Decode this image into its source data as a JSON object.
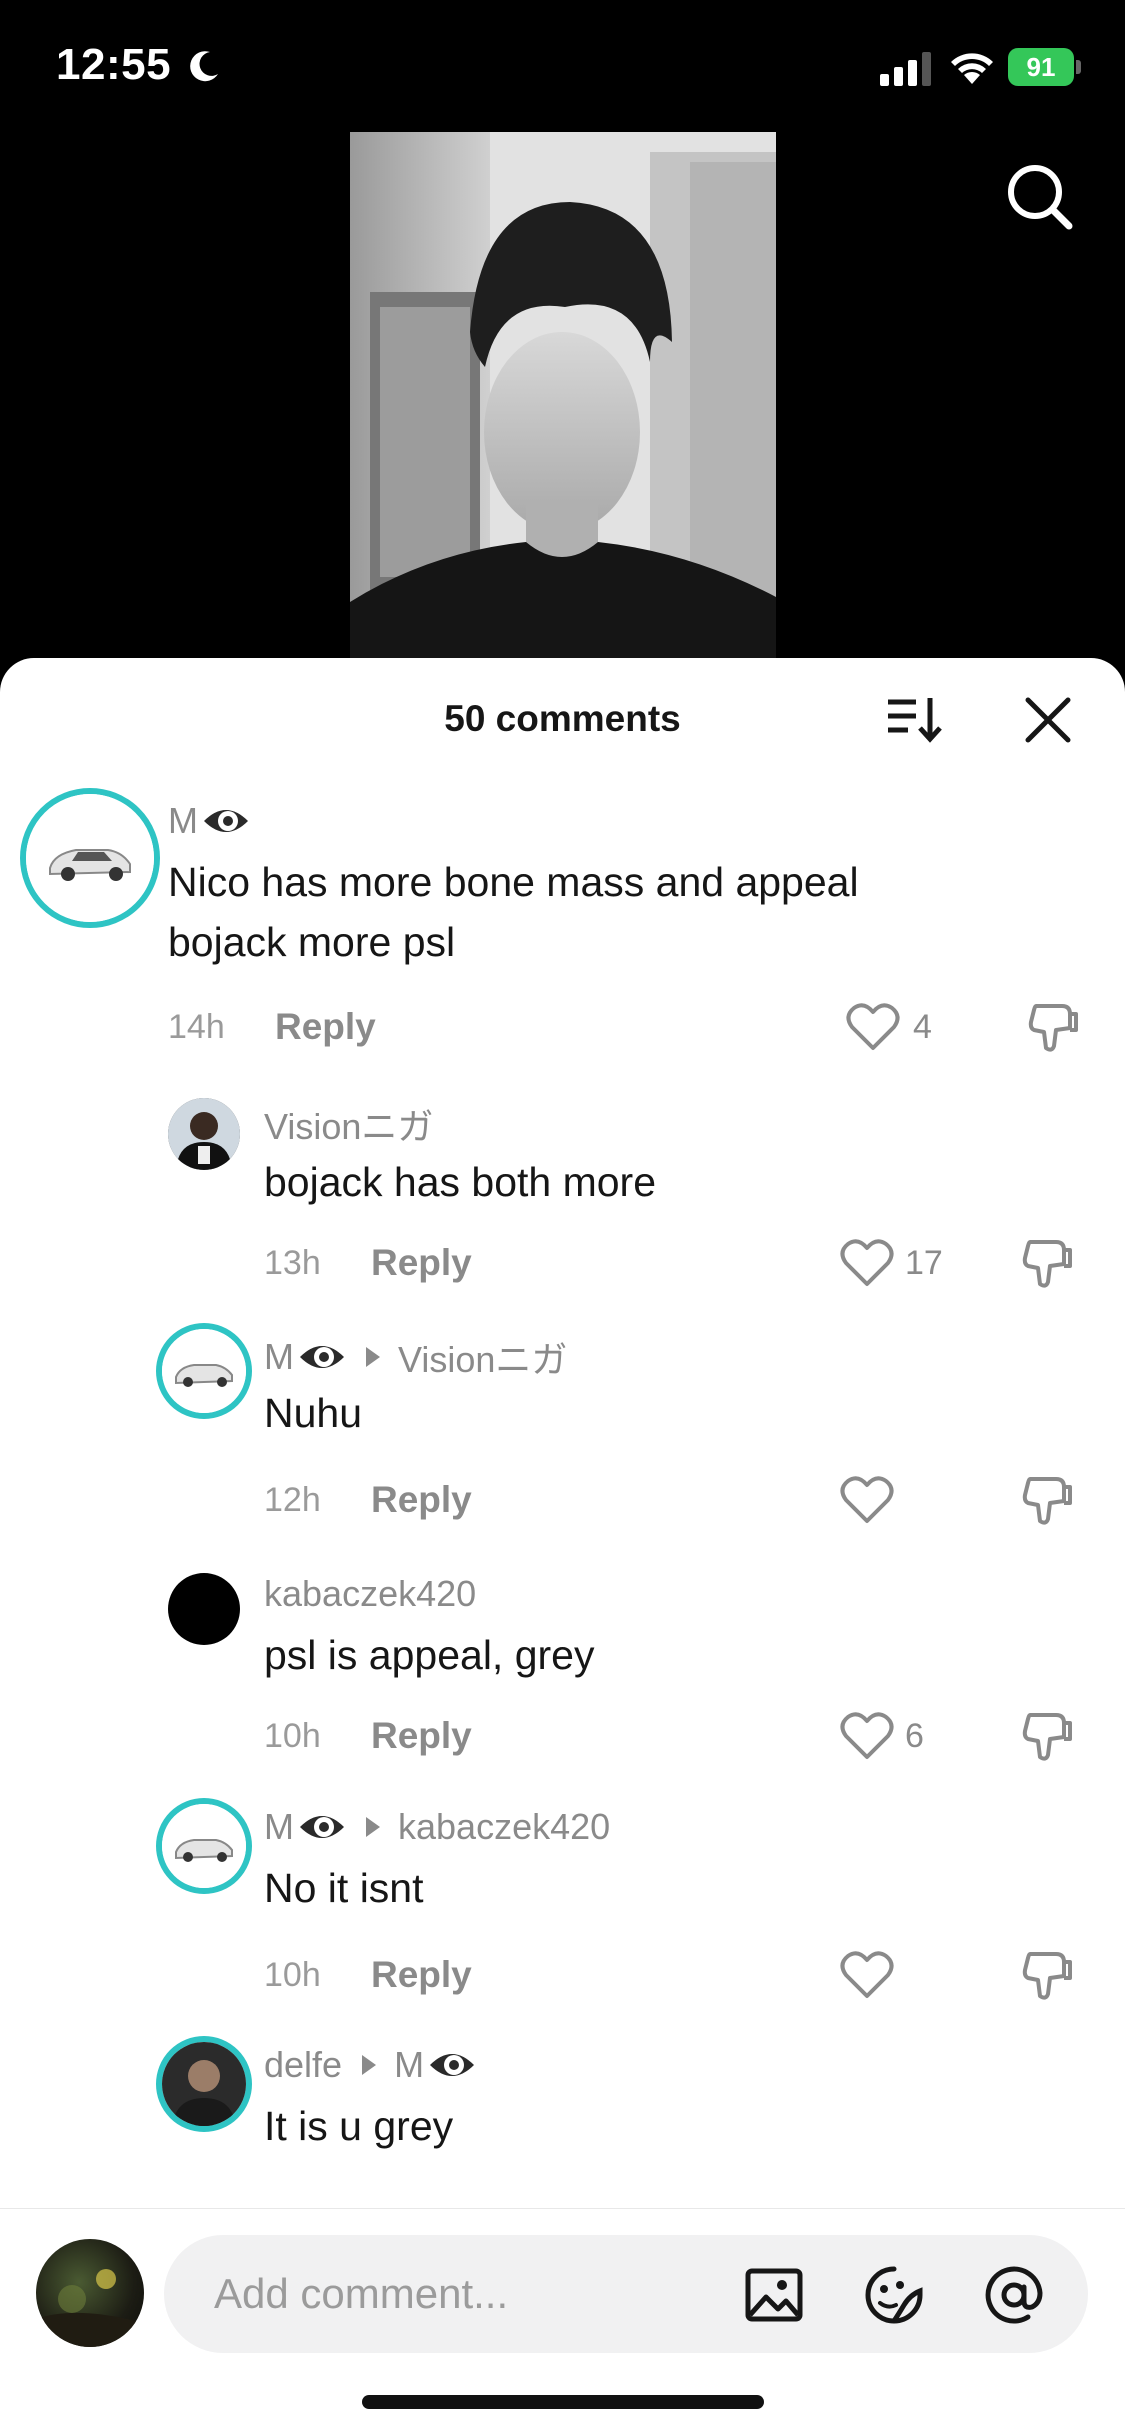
{
  "status_bar": {
    "time": "12:55",
    "battery": "91"
  },
  "sheet": {
    "title": "50 comments"
  },
  "comments": [
    {
      "username": "M",
      "text": "Nico has more bone mass and appeal bojack more psl",
      "time": "14h",
      "reply_label": "Reply",
      "likes": "4"
    },
    {
      "username": "Visionニガ",
      "text": "bojack has both more",
      "time": "13h",
      "reply_label": "Reply",
      "likes": "17"
    },
    {
      "username": "M",
      "reply_to": "Visionニガ",
      "text": "Nuhu",
      "time": "12h",
      "reply_label": "Reply",
      "likes": ""
    },
    {
      "username": "kabaczek420",
      "text": "psl is appeal, grey",
      "time": "10h",
      "reply_label": "Reply",
      "likes": "6"
    },
    {
      "username": "M",
      "reply_to": "kabaczek420",
      "text": "No it isnt",
      "time": "10h",
      "reply_label": "Reply",
      "likes": ""
    },
    {
      "username": "delfe",
      "reply_to": "M",
      "text": "It is u grey"
    }
  ],
  "input": {
    "placeholder": "Add comment..."
  },
  "icons": {
    "search": "search-icon",
    "sort": "sort-icon",
    "close": "close-icon",
    "like": "heart-icon",
    "dislike": "thumbs-down-icon",
    "image": "image-icon",
    "emoji": "emoji-icon",
    "mention": "at-icon"
  },
  "colors": {
    "accent_ring": "#2ec4c4",
    "battery": "#34c759",
    "text_primary": "#161616",
    "text_secondary": "#8a8a8a"
  }
}
